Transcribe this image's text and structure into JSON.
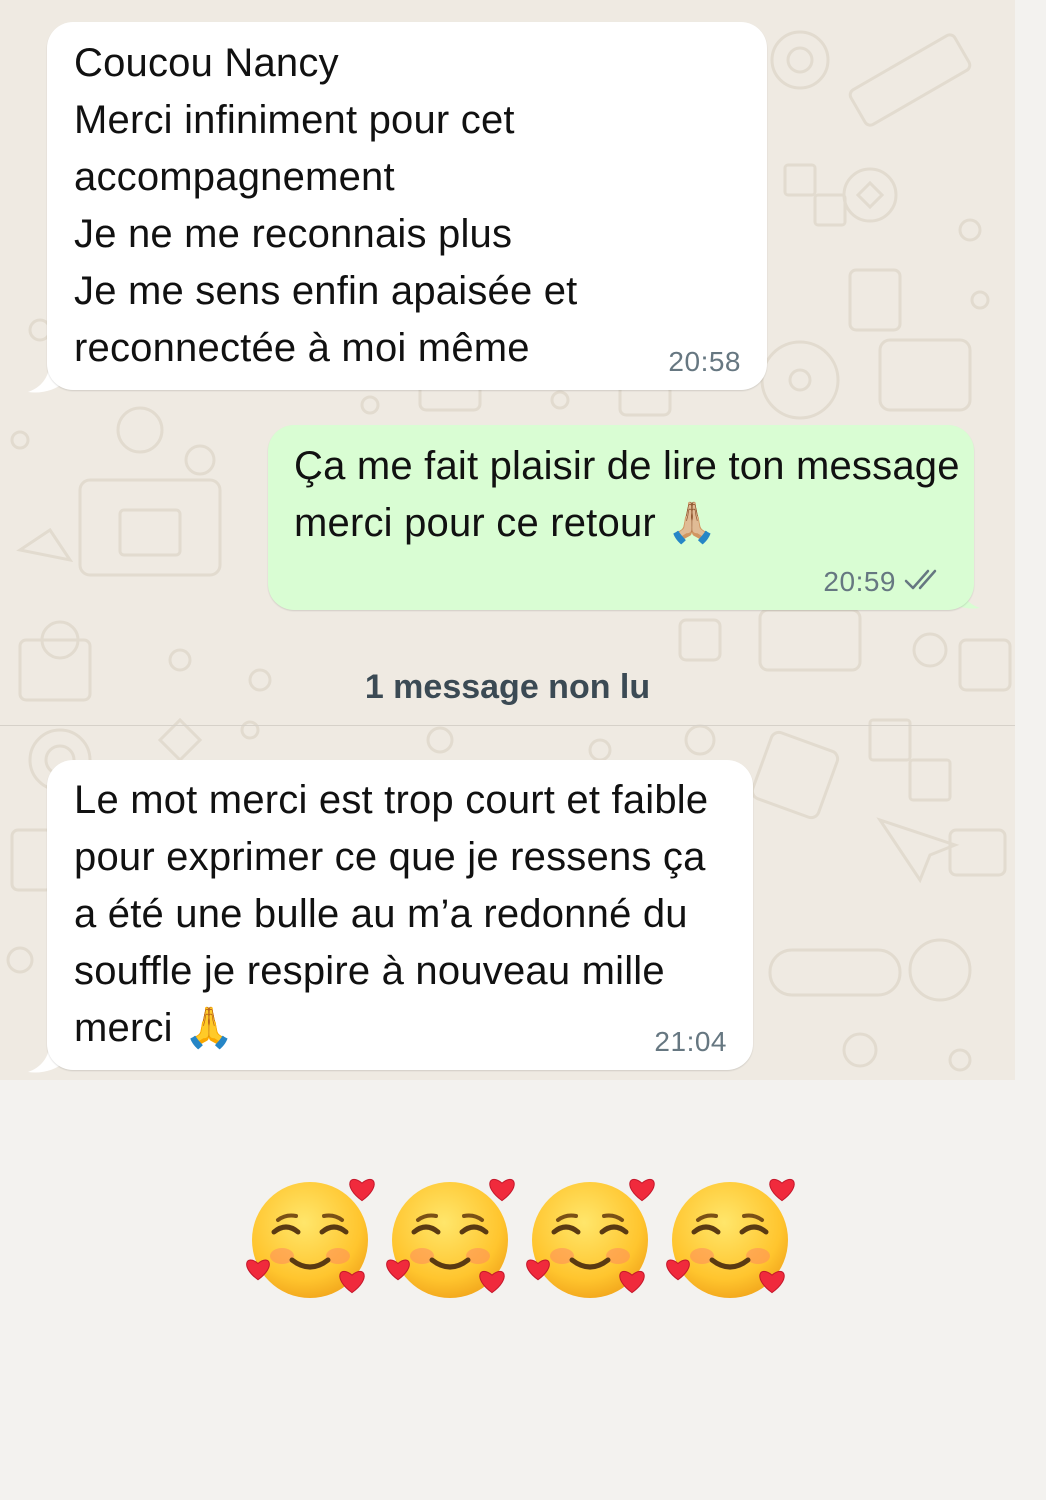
{
  "messages": [
    {
      "direction": "incoming",
      "text": "Coucou Nancy\nMerci infiniment pour cet accompagnement\nJe ne me reconnais plus\nJe me sens enfin apaisée et reconnectée à moi même",
      "time": "20:58"
    },
    {
      "direction": "outgoing",
      "text": "Ça me fait plaisir de lire ton message merci pour ce retour 🙏🏼",
      "time": "20:59",
      "status_icon": "double-check-icon"
    },
    {
      "direction": "incoming",
      "text": "Le mot merci est trop court et faible pour exprimer ce que je ressens ça a été une bulle au m’a redonné du souffle je respire à nouveau mille merci 🙏",
      "time": "21:04"
    }
  ],
  "unread_banner": "1 message non lu",
  "reaction_emojis": [
    "🥰",
    "🥰",
    "🥰",
    "🥰"
  ],
  "colors": {
    "chat_background": "#efeae2",
    "incoming_bubble": "#ffffff",
    "outgoing_bubble": "#d9fdd3",
    "timestamp": "#667781",
    "page_background": "#f3f2ef"
  }
}
